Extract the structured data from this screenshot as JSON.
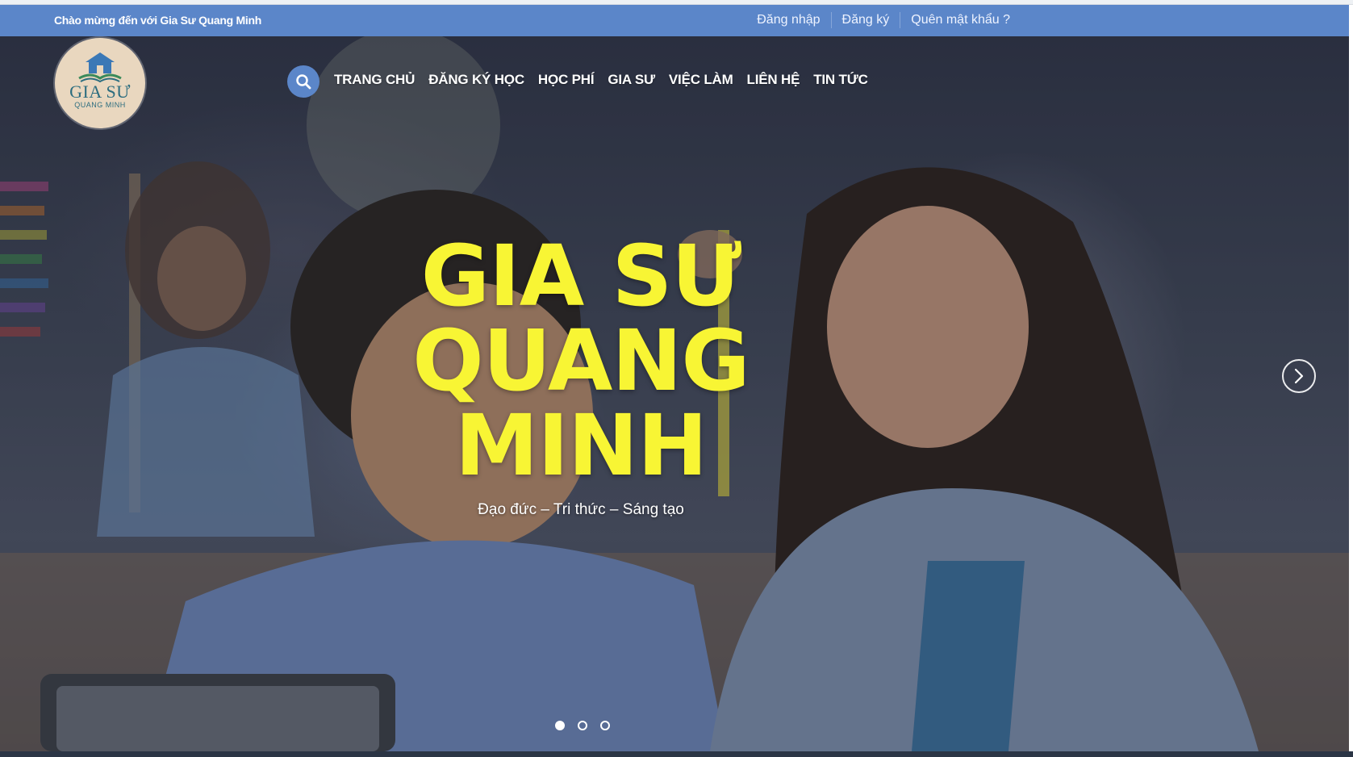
{
  "topbar": {
    "welcome": "Chào mừng đến với Gia Sư Quang Minh",
    "login": "Đăng nhập",
    "register": "Đăng ký",
    "forgot_password": "Quên mật khẩu ?"
  },
  "logo": {
    "title": "GIA SƯ",
    "subtitle": "QUANG MINH",
    "icon": "house-book-logo"
  },
  "nav": {
    "search_icon": "search-icon",
    "items": [
      {
        "label": "TRANG CHỦ"
      },
      {
        "label": "ĐĂNG KÝ HỌC"
      },
      {
        "label": "HỌC PHÍ"
      },
      {
        "label": "GIA SƯ"
      },
      {
        "label": "VIỆC LÀM"
      },
      {
        "label": "LIÊN HỆ"
      },
      {
        "label": "TIN TỨC"
      }
    ]
  },
  "hero": {
    "title_line1": "GIA SƯ",
    "title_line2": "QUANG",
    "title_line3": "MINH",
    "subtitle": "Đạo đức – Tri thức – Sáng tạo",
    "next_icon": "chevron-right-icon",
    "slide_count": 3,
    "active_slide": 1
  },
  "colors": {
    "topbar": "#5b86c9",
    "title_yellow": "#f8f534",
    "search_button": "#5b86c9"
  }
}
